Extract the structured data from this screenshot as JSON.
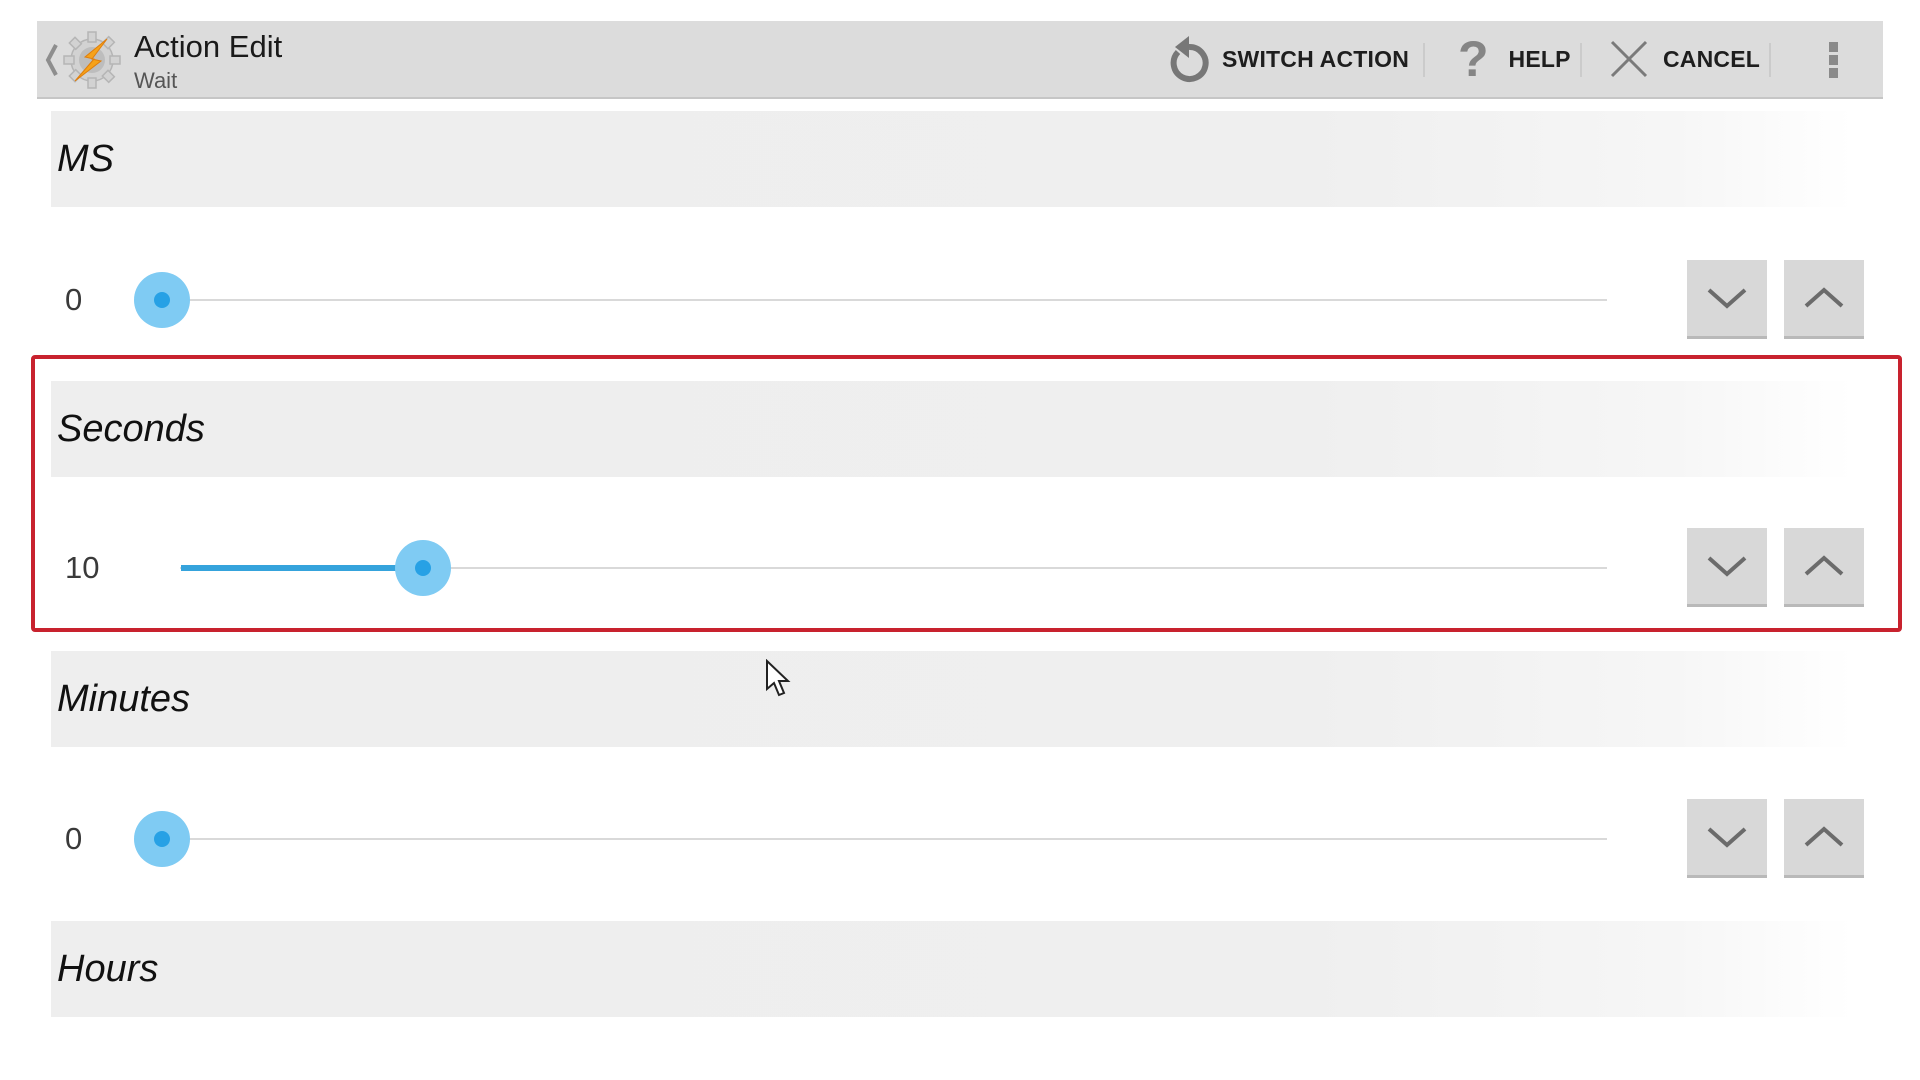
{
  "header": {
    "title": "Action Edit",
    "subtitle": "Wait",
    "back_icon": "chevron-left-icon",
    "app_icon": "tasker-gear-bolt-icon",
    "actions": [
      {
        "label": "SWITCH ACTION",
        "icon": "rotate-ccw-icon"
      },
      {
        "label": "HELP",
        "icon": "question-mark-icon"
      },
      {
        "label": "CANCEL",
        "icon": "close-x-icon"
      }
    ],
    "overflow_icon": "more-vertical-icon"
  },
  "fields": [
    {
      "label": "MS",
      "value": 0,
      "value_text": "0",
      "min": 0,
      "max": 999,
      "highlighted": false
    },
    {
      "label": "Seconds",
      "value": 10,
      "value_text": "10",
      "min": 0,
      "max": 59,
      "highlighted": true
    },
    {
      "label": "Minutes",
      "value": 0,
      "value_text": "0",
      "min": 0,
      "max": 59,
      "highlighted": false
    },
    {
      "label": "Hours",
      "highlighted": false
    }
  ],
  "colors": {
    "accent": "#35a3dc",
    "thumb_outer": "#7fcbf3",
    "thumb_inner": "#27a1e5",
    "highlight_border": "#c8222e",
    "header_bg": "#dcdcdc"
  },
  "icons": {
    "decrement": "chevron-down-icon",
    "increment": "chevron-up-icon",
    "cursor": "mouse-pointer-icon"
  }
}
